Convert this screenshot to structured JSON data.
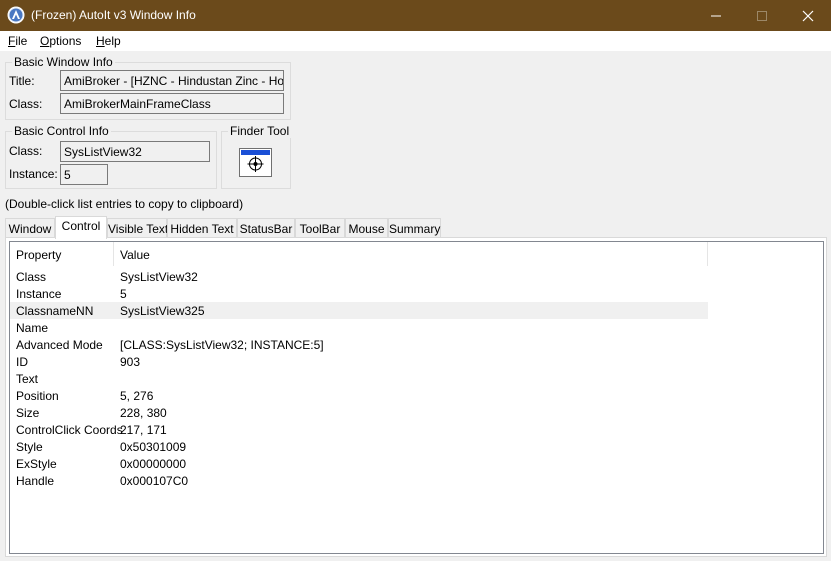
{
  "window": {
    "title": "(Frozen) AutoIt v3 Window Info",
    "colors": {
      "titlebar": "#6b4a1b",
      "selected_row": "#f0f0f0"
    }
  },
  "menu": {
    "items": [
      {
        "label_u": "F",
        "label_rest": "ile"
      },
      {
        "label_u": "O",
        "label_rest": "ptions"
      },
      {
        "label_u": "H",
        "label_rest": "elp"
      }
    ]
  },
  "basic_window": {
    "group_label": "Basic Window Info",
    "title_label": "Title:",
    "title_value": "AmiBroker - [HZNC - Hindustan Zinc - Hourly]",
    "class_label": "Class:",
    "class_value": "AmiBrokerMainFrameClass"
  },
  "basic_control": {
    "group_label": "Basic Control Info",
    "class_label": "Class:",
    "class_value": "SysListView32",
    "instance_label": "Instance:",
    "instance_value": "5"
  },
  "finder": {
    "group_label": "Finder Tool",
    "icon": "crosshair-target-icon"
  },
  "hint": "(Double-click list entries to copy to clipboard)",
  "tabs": [
    {
      "label": "Window",
      "active": false
    },
    {
      "label": "Control",
      "active": true
    },
    {
      "label": "Visible Text",
      "active": false
    },
    {
      "label": "Hidden Text",
      "active": false
    },
    {
      "label": "StatusBar",
      "active": false
    },
    {
      "label": "ToolBar",
      "active": false
    },
    {
      "label": "Mouse",
      "active": false
    },
    {
      "label": "Summary",
      "active": false
    }
  ],
  "table": {
    "headers": {
      "property": "Property",
      "value": "Value"
    },
    "rows": [
      {
        "property": "Class",
        "value": "SysListView32"
      },
      {
        "property": "Instance",
        "value": "5"
      },
      {
        "property": "ClassnameNN",
        "value": "SysListView325",
        "selected": true
      },
      {
        "property": "Name",
        "value": ""
      },
      {
        "property": "Advanced Mode",
        "value": "[CLASS:SysListView32; INSTANCE:5]"
      },
      {
        "property": "ID",
        "value": "903"
      },
      {
        "property": "Text",
        "value": ""
      },
      {
        "property": "Position",
        "value": "5, 276"
      },
      {
        "property": "Size",
        "value": "228, 380"
      },
      {
        "property": "ControlClick Coords",
        "value": "217, 171"
      },
      {
        "property": "Style",
        "value": "0x50301009"
      },
      {
        "property": "ExStyle",
        "value": "0x00000000"
      },
      {
        "property": "Handle",
        "value": "0x000107C0"
      }
    ]
  }
}
